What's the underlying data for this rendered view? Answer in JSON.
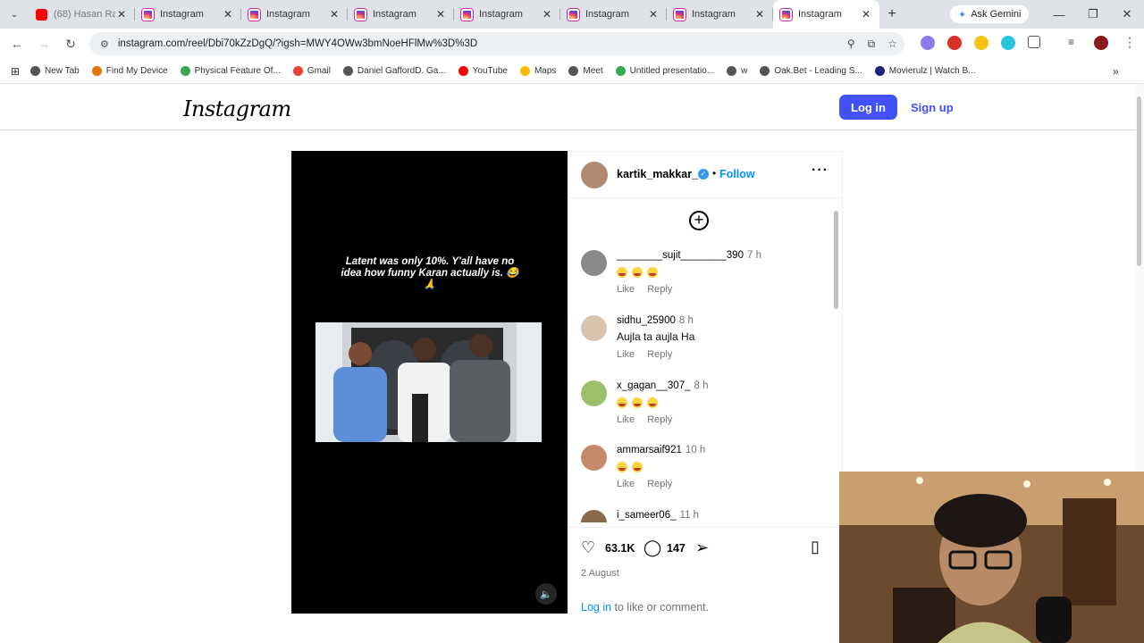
{
  "browser": {
    "tabs": [
      {
        "label": "(68) Hasan Ra",
        "favicon": "youtube-icon"
      },
      {
        "label": "Instagram",
        "favicon": "instagram-icon"
      },
      {
        "label": "Instagram",
        "favicon": "instagram-icon"
      },
      {
        "label": "Instagram",
        "favicon": "instagram-icon"
      },
      {
        "label": "Instagram",
        "favicon": "instagram-icon"
      },
      {
        "label": "Instagram",
        "favicon": "instagram-icon"
      },
      {
        "label": "Instagram",
        "favicon": "instagram-icon"
      },
      {
        "label": "Instagram",
        "favicon": "instagram-icon",
        "active": true
      }
    ],
    "gemini_label": "Ask Gemini",
    "url": "instagram.com/reel/Dbi70kZzDgQ/?igsh=MWY4OWw3bmNoeHFlMw%3D%3D",
    "bookmarks": [
      {
        "label": "New Tab",
        "icon": "globe-icon",
        "color": "#555555"
      },
      {
        "label": "Find My Device",
        "icon": "device-icon",
        "color": "#e37400"
      },
      {
        "label": "Physical Feature Of...",
        "icon": "drive-icon",
        "color": "#34a853"
      },
      {
        "label": "Gmail",
        "icon": "gmail-icon",
        "color": "#ea4335"
      },
      {
        "label": "Daniel GaffordD. Ga...",
        "icon": "globe-icon",
        "color": "#555555"
      },
      {
        "label": "YouTube",
        "icon": "youtube-icon",
        "color": "#ff0000"
      },
      {
        "label": "Maps",
        "icon": "maps-icon",
        "color": "#fbbc04"
      },
      {
        "label": "Meet",
        "icon": "globe-icon",
        "color": "#555555"
      },
      {
        "label": "Untitled presentatio...",
        "icon": "drive-icon",
        "color": "#34a853"
      },
      {
        "label": "w",
        "icon": "globe-icon",
        "color": "#555555"
      },
      {
        "label": "Oak.Bet - Leading S...",
        "icon": "globe-icon",
        "color": "#555555"
      },
      {
        "label": "Movierulz | Watch B...",
        "icon": "movie-icon",
        "color": "#1a237e"
      }
    ]
  },
  "instagram": {
    "logo": "Instagram",
    "login_label": "Log in",
    "signup_label": "Sign up",
    "reel": {
      "overlay_text": "Latent was only 10%. Y'all have no idea how funny Karan actually is. 😂🙏"
    },
    "post": {
      "author": "kartik_makkar_",
      "follow_label": "Follow",
      "comments": [
        {
          "user": "________sujit________390",
          "time": "7 h",
          "text": "",
          "emoji_count": 3
        },
        {
          "user": "sidhu_25900",
          "time": "8 h",
          "text": "Aujla ta aujla Ha",
          "emoji_count": 0
        },
        {
          "user": "x_gagan__307_",
          "time": "8 h",
          "text": "",
          "emoji_count": 3
        },
        {
          "user": "ammarsaif921",
          "time": "10 h",
          "text": "",
          "emoji_count": 2
        },
        {
          "user": "i_sameer06_",
          "time": "11 h",
          "text": "",
          "emoji_count": 0
        }
      ],
      "like_label": "Like",
      "reply_label": "Reply",
      "likes": "63.1K",
      "comment_count": "147",
      "date": "2 August",
      "login_link": "Log in",
      "login_suffix": " to like or comment."
    }
  }
}
